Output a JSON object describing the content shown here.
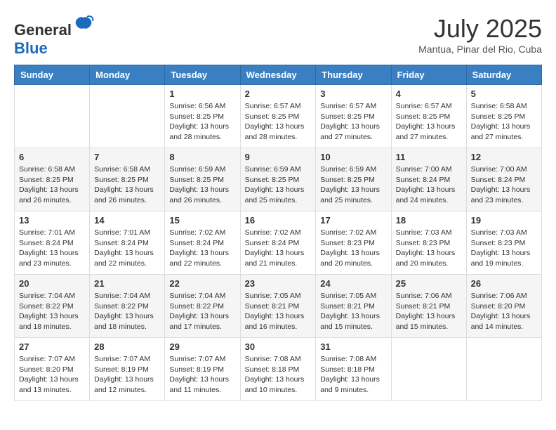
{
  "header": {
    "logo_general": "General",
    "logo_blue": "Blue",
    "month": "July 2025",
    "location": "Mantua, Pinar del Rio, Cuba"
  },
  "days_of_week": [
    "Sunday",
    "Monday",
    "Tuesday",
    "Wednesday",
    "Thursday",
    "Friday",
    "Saturday"
  ],
  "weeks": [
    [
      {
        "day": "",
        "info": ""
      },
      {
        "day": "",
        "info": ""
      },
      {
        "day": "1",
        "info": "Sunrise: 6:56 AM\nSunset: 8:25 PM\nDaylight: 13 hours and 28 minutes."
      },
      {
        "day": "2",
        "info": "Sunrise: 6:57 AM\nSunset: 8:25 PM\nDaylight: 13 hours and 28 minutes."
      },
      {
        "day": "3",
        "info": "Sunrise: 6:57 AM\nSunset: 8:25 PM\nDaylight: 13 hours and 27 minutes."
      },
      {
        "day": "4",
        "info": "Sunrise: 6:57 AM\nSunset: 8:25 PM\nDaylight: 13 hours and 27 minutes."
      },
      {
        "day": "5",
        "info": "Sunrise: 6:58 AM\nSunset: 8:25 PM\nDaylight: 13 hours and 27 minutes."
      }
    ],
    [
      {
        "day": "6",
        "info": "Sunrise: 6:58 AM\nSunset: 8:25 PM\nDaylight: 13 hours and 26 minutes."
      },
      {
        "day": "7",
        "info": "Sunrise: 6:58 AM\nSunset: 8:25 PM\nDaylight: 13 hours and 26 minutes."
      },
      {
        "day": "8",
        "info": "Sunrise: 6:59 AM\nSunset: 8:25 PM\nDaylight: 13 hours and 26 minutes."
      },
      {
        "day": "9",
        "info": "Sunrise: 6:59 AM\nSunset: 8:25 PM\nDaylight: 13 hours and 25 minutes."
      },
      {
        "day": "10",
        "info": "Sunrise: 6:59 AM\nSunset: 8:25 PM\nDaylight: 13 hours and 25 minutes."
      },
      {
        "day": "11",
        "info": "Sunrise: 7:00 AM\nSunset: 8:24 PM\nDaylight: 13 hours and 24 minutes."
      },
      {
        "day": "12",
        "info": "Sunrise: 7:00 AM\nSunset: 8:24 PM\nDaylight: 13 hours and 23 minutes."
      }
    ],
    [
      {
        "day": "13",
        "info": "Sunrise: 7:01 AM\nSunset: 8:24 PM\nDaylight: 13 hours and 23 minutes."
      },
      {
        "day": "14",
        "info": "Sunrise: 7:01 AM\nSunset: 8:24 PM\nDaylight: 13 hours and 22 minutes."
      },
      {
        "day": "15",
        "info": "Sunrise: 7:02 AM\nSunset: 8:24 PM\nDaylight: 13 hours and 22 minutes."
      },
      {
        "day": "16",
        "info": "Sunrise: 7:02 AM\nSunset: 8:24 PM\nDaylight: 13 hours and 21 minutes."
      },
      {
        "day": "17",
        "info": "Sunrise: 7:02 AM\nSunset: 8:23 PM\nDaylight: 13 hours and 20 minutes."
      },
      {
        "day": "18",
        "info": "Sunrise: 7:03 AM\nSunset: 8:23 PM\nDaylight: 13 hours and 20 minutes."
      },
      {
        "day": "19",
        "info": "Sunrise: 7:03 AM\nSunset: 8:23 PM\nDaylight: 13 hours and 19 minutes."
      }
    ],
    [
      {
        "day": "20",
        "info": "Sunrise: 7:04 AM\nSunset: 8:22 PM\nDaylight: 13 hours and 18 minutes."
      },
      {
        "day": "21",
        "info": "Sunrise: 7:04 AM\nSunset: 8:22 PM\nDaylight: 13 hours and 18 minutes."
      },
      {
        "day": "22",
        "info": "Sunrise: 7:04 AM\nSunset: 8:22 PM\nDaylight: 13 hours and 17 minutes."
      },
      {
        "day": "23",
        "info": "Sunrise: 7:05 AM\nSunset: 8:21 PM\nDaylight: 13 hours and 16 minutes."
      },
      {
        "day": "24",
        "info": "Sunrise: 7:05 AM\nSunset: 8:21 PM\nDaylight: 13 hours and 15 minutes."
      },
      {
        "day": "25",
        "info": "Sunrise: 7:06 AM\nSunset: 8:21 PM\nDaylight: 13 hours and 15 minutes."
      },
      {
        "day": "26",
        "info": "Sunrise: 7:06 AM\nSunset: 8:20 PM\nDaylight: 13 hours and 14 minutes."
      }
    ],
    [
      {
        "day": "27",
        "info": "Sunrise: 7:07 AM\nSunset: 8:20 PM\nDaylight: 13 hours and 13 minutes."
      },
      {
        "day": "28",
        "info": "Sunrise: 7:07 AM\nSunset: 8:19 PM\nDaylight: 13 hours and 12 minutes."
      },
      {
        "day": "29",
        "info": "Sunrise: 7:07 AM\nSunset: 8:19 PM\nDaylight: 13 hours and 11 minutes."
      },
      {
        "day": "30",
        "info": "Sunrise: 7:08 AM\nSunset: 8:18 PM\nDaylight: 13 hours and 10 minutes."
      },
      {
        "day": "31",
        "info": "Sunrise: 7:08 AM\nSunset: 8:18 PM\nDaylight: 13 hours and 9 minutes."
      },
      {
        "day": "",
        "info": ""
      },
      {
        "day": "",
        "info": ""
      }
    ]
  ]
}
